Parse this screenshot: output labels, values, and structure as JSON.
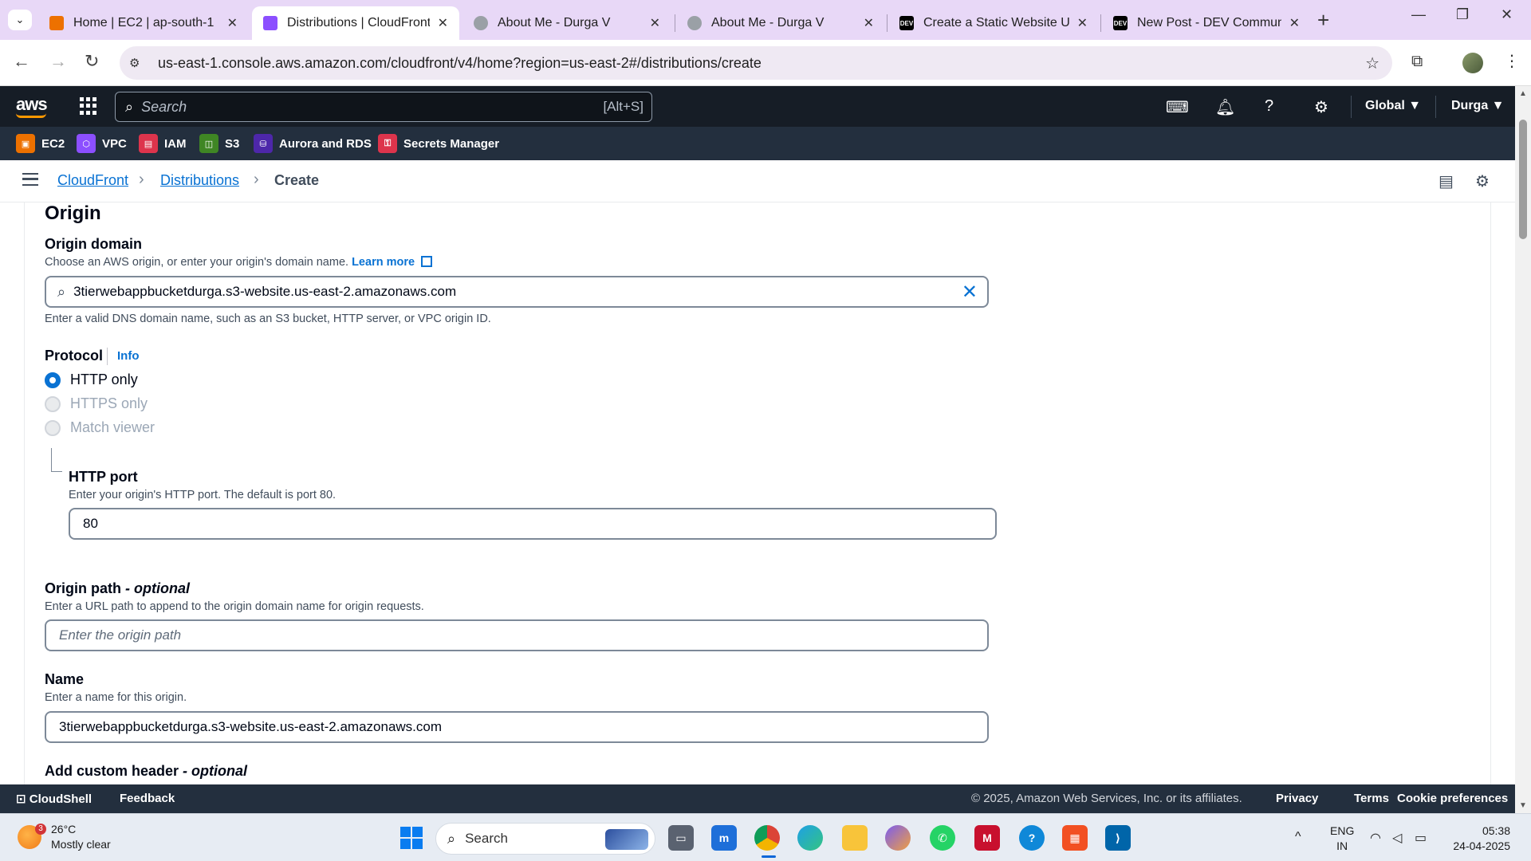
{
  "browser": {
    "tabs": [
      {
        "label": "Home | EC2 | ap-south-1",
        "favicon": "aws-ec2-icon",
        "color": "#ed7100",
        "active": false
      },
      {
        "label": "Distributions | CloudFront | ",
        "favicon": "aws-cloudfront-icon",
        "color": "#8c4fff",
        "active": true
      },
      {
        "label": "About Me - Durga V",
        "favicon": "globe-icon",
        "color": "#9aa0a6",
        "active": false
      },
      {
        "label": "About Me - Durga V",
        "favicon": "globe-icon",
        "color": "#9aa0a6",
        "active": false
      },
      {
        "label": "Create a Static Website Usi",
        "favicon": "dev-icon",
        "color": "#000000",
        "active": false
      },
      {
        "label": "New Post - DEV Communi",
        "favicon": "dev-icon",
        "color": "#000000",
        "active": false
      }
    ],
    "dev_badge": "DEV",
    "url": "us-east-1.console.aws.amazon.com/cloudfront/v4/home?region=us-east-2#/distributions/create"
  },
  "aws": {
    "logo": "aws",
    "search_placeholder": "Search",
    "search_shortcut": "[Alt+S]",
    "region": "Global ▼",
    "user": "Durga ▼",
    "favorites": [
      {
        "label": "EC2",
        "color": "#ed7100"
      },
      {
        "label": "VPC",
        "color": "#8c4fff"
      },
      {
        "label": "IAM",
        "color": "#dd344c"
      },
      {
        "label": "S3",
        "color": "#3f8624"
      },
      {
        "label": "Aurora and RDS",
        "color": "#4d27aa"
      },
      {
        "label": "Secrets Manager",
        "color": "#dd344c"
      }
    ],
    "breadcrumb": {
      "items": [
        "CloudFront",
        "Distributions"
      ],
      "current": "Create"
    }
  },
  "form": {
    "section_title": "Origin",
    "origin_domain": {
      "label": "Origin domain",
      "description": "Choose an AWS origin, or enter your origin's domain name.",
      "learn_more": "Learn more",
      "value": "3tierwebappbucketdurga.s3-website.us-east-2.amazonaws.com",
      "hint": "Enter a valid DNS domain name, such as an S3 bucket, HTTP server, or VPC origin ID."
    },
    "protocol": {
      "label": "Protocol",
      "info": "Info",
      "options": [
        {
          "label": "HTTP only",
          "selected": true,
          "disabled": false
        },
        {
          "label": "HTTPS only",
          "selected": false,
          "disabled": true
        },
        {
          "label": "Match viewer",
          "selected": false,
          "disabled": true
        }
      ]
    },
    "http_port": {
      "label": "HTTP port",
      "description": "Enter your origin's HTTP port. The default is port 80.",
      "value": "80"
    },
    "origin_path": {
      "label": "Origin path",
      "optional": "- optional",
      "description": "Enter a URL path to append to the origin domain name for origin requests.",
      "placeholder": "Enter the origin path"
    },
    "name": {
      "label": "Name",
      "description": "Enter a name for this origin.",
      "value": "3tierwebappbucketdurga.s3-website.us-east-2.amazonaws.com"
    },
    "custom_header": {
      "label": "Add custom header",
      "optional": "- optional"
    }
  },
  "footer": {
    "cloudshell": "CloudShell",
    "feedback": "Feedback",
    "copyright": "© 2025, Amazon Web Services, Inc. or its affiliates.",
    "privacy": "Privacy",
    "terms": "Terms",
    "cookies": "Cookie preferences"
  },
  "taskbar": {
    "weather_temp": "26°C",
    "weather_desc": "Mostly clear",
    "weather_badge": "3",
    "search": "Search",
    "lang_top": "ENG",
    "lang_bottom": "IN",
    "time": "05:38",
    "date": "24-04-2025"
  }
}
